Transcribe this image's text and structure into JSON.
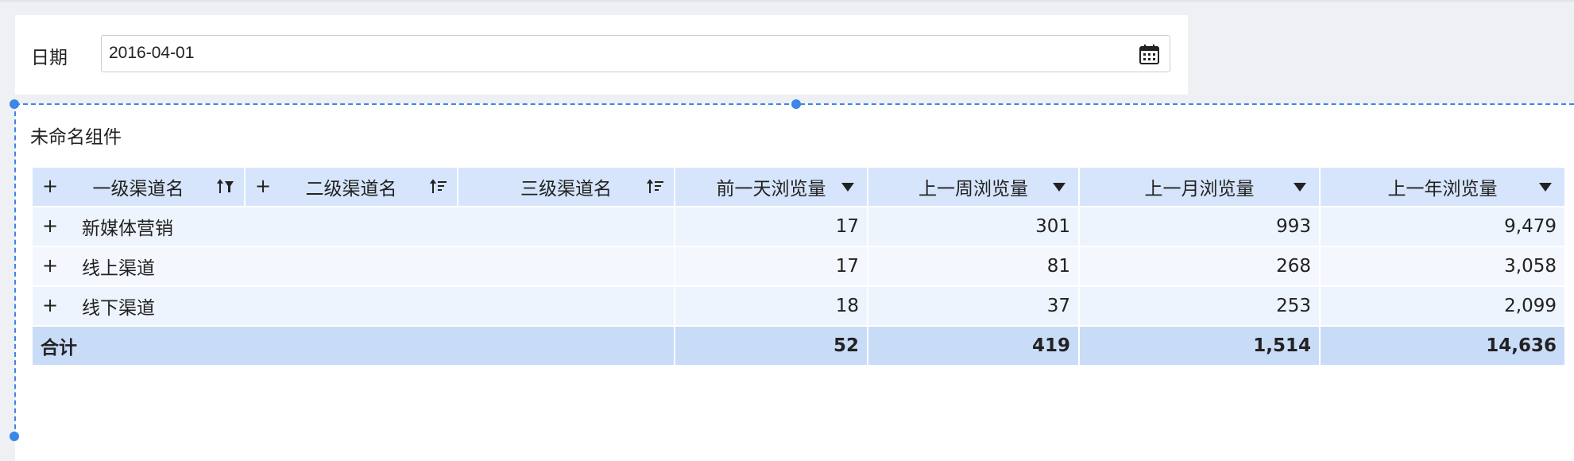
{
  "filter": {
    "label": "日期",
    "date_value": "2016-04-01"
  },
  "widget": {
    "title": "未命名组件"
  },
  "table": {
    "columns": [
      "一级渠道名",
      "二级渠道名",
      "三级渠道名",
      "前一天浏览量",
      "上一周浏览量",
      "上一月浏览量",
      "上一年浏览量"
    ],
    "rows": [
      {
        "channel": "新媒体营销",
        "day": "17",
        "week": "301",
        "month": "993",
        "year": "9,479"
      },
      {
        "channel": "线上渠道",
        "day": "17",
        "week": "81",
        "month": "268",
        "year": "3,058"
      },
      {
        "channel": "线下渠道",
        "day": "18",
        "week": "37",
        "month": "253",
        "year": "2,099"
      }
    ],
    "total": {
      "label": "合计",
      "day": "52",
      "week": "419",
      "month": "1,514",
      "year": "14,636"
    },
    "expand_symbol": "+"
  },
  "icons": {
    "calendar": "calendar-icon",
    "sort": "sort-icon",
    "dropdown": "caret-down-icon",
    "expand": "plus-icon"
  },
  "colors": {
    "accent": "#3b86e6",
    "header_bg": "#d6e5fb",
    "row_bg": "#eef4fd",
    "total_bg": "#c9dcf7"
  }
}
